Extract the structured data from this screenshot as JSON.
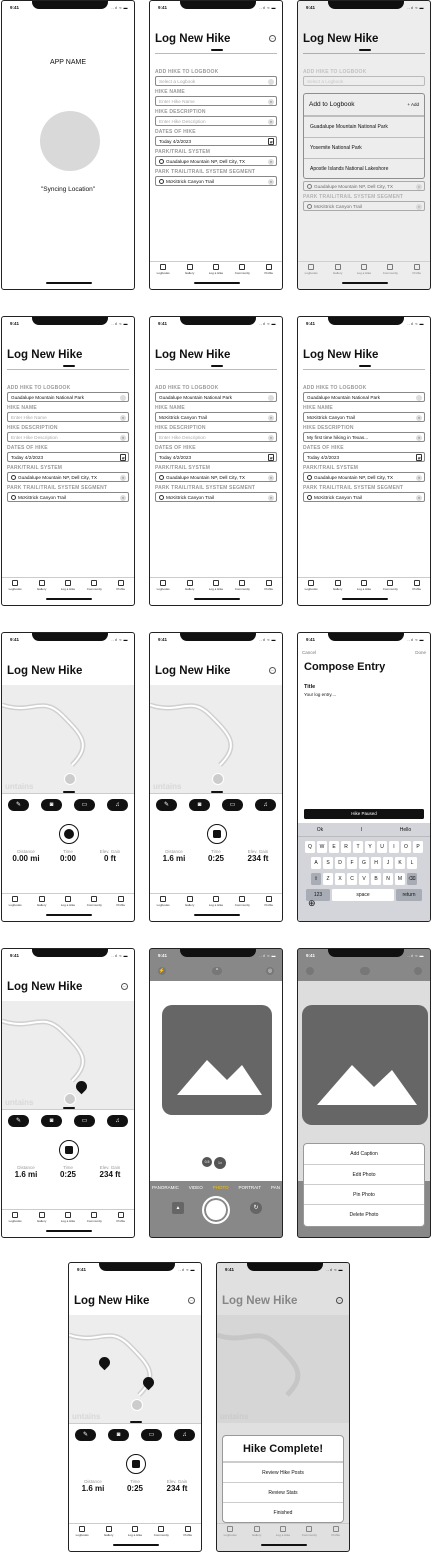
{
  "status": {
    "time": "9:41",
    "icons": "..ıl ≈ ▬"
  },
  "screen1": {
    "app_name": "APP NAME",
    "syncing": "\"Syncing Location\""
  },
  "form": {
    "title": "Log New Hike",
    "labels": {
      "logbook": "ADD HIKE TO LOGBOOK",
      "name": "HIKE NAME",
      "desc": "HIKE DESCRIPTION",
      "dates": "DATES OF HIKE",
      "park": "PARK/TRAIL SYSTEM",
      "segment": "PARK TRAIL/TRAIL SYSTEM SEGMENT"
    },
    "placeholders": {
      "logbook": "Select a Logbook",
      "name": "Enter Hike Name",
      "desc": "Enter Hike Description"
    },
    "values": {
      "date_today": "Today 4/2/2023",
      "date": "Today 4/2/2023",
      "park": "Guadalupe Mountain NP, Dell City, TX",
      "segment": "McKittrick Canyon Trail",
      "logbook": "Guadalupe Mountain National Park",
      "name": "McKittrick Canyon Trail",
      "desc": "My first time hiking in Texas..."
    }
  },
  "dropdown": {
    "title": "Add to Logbook",
    "add": "+ Add",
    "items": [
      "Guadalupe Mountain National Park",
      "Yosemite National Park",
      "Apostle Islands National Lakeshore"
    ]
  },
  "tabs": [
    "Logbooks",
    "Gallery",
    "Log a Hike",
    "Community",
    "Profile"
  ],
  "tracker": {
    "map_label": "untains",
    "tools": [
      "✎",
      "◙",
      "▭",
      "♫"
    ],
    "stats_labels": [
      "Distance",
      "Time",
      "Elev. Gain"
    ],
    "stats_start": [
      "0.00 mi",
      "0:00",
      "0 ft"
    ],
    "stats_live": [
      "1.6 mi",
      "0:25",
      "234 ft"
    ]
  },
  "compose": {
    "cancel": "Cancel",
    "done": "Done",
    "title": "Compose Entry",
    "field_title": "Title",
    "body": "Your log entry....",
    "button": "Hike Paused",
    "suggestions": [
      "Ok",
      "I",
      "Hello"
    ],
    "rows": [
      [
        "Q",
        "W",
        "E",
        "R",
        "T",
        "Y",
        "U",
        "I",
        "O",
        "P"
      ],
      [
        "A",
        "S",
        "D",
        "F",
        "G",
        "H",
        "J",
        "K",
        "L"
      ],
      [
        "Z",
        "X",
        "C",
        "V",
        "B",
        "N",
        "M"
      ]
    ],
    "num": "123",
    "space": "space",
    "return": "return"
  },
  "camera": {
    "modes": [
      "PANORAMIC",
      "VIDEO",
      "PHOTO",
      "PORTRAIT",
      "PAN"
    ],
    "zoom": [
      "0.5",
      "1x"
    ]
  },
  "photo_menu": [
    "Add Caption",
    "Edit Photo",
    "Pin Photo",
    "Delete Photo"
  ],
  "complete": {
    "title": "Hike Complete!",
    "options": [
      "Review Hike Posts",
      "Review Stats",
      "Finished"
    ]
  }
}
